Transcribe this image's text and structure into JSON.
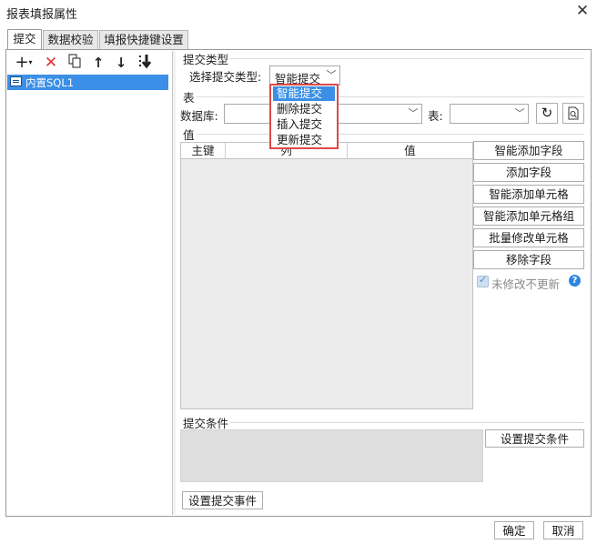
{
  "window": {
    "title": "报表填报属性"
  },
  "tabs": [
    "提交",
    "数据校验",
    "填报快捷键设置"
  ],
  "left": {
    "items": [
      {
        "label": "内置SQL1",
        "selected": true
      }
    ]
  },
  "submit_type": {
    "section_label": "提交类型",
    "select_label": "选择提交类型:",
    "value": "智能提交",
    "options": [
      "智能提交",
      "删除提交",
      "插入提交",
      "更新提交"
    ]
  },
  "table_section": {
    "label": "表",
    "database_label": "数据库:",
    "table_label": "表:"
  },
  "value_section": {
    "label": "值",
    "columns": [
      "主键",
      "列",
      "值"
    ],
    "buttons": [
      "智能添加字段",
      "添加字段",
      "智能添加单元格",
      "智能添加单元格组",
      "批量修改单元格",
      "移除字段"
    ],
    "checkbox_label": "未修改不更新",
    "checkbox_checked": true
  },
  "condition": {
    "label": "提交条件",
    "button": "设置提交条件"
  },
  "event_button": "设置提交事件",
  "footer": {
    "ok": "确定",
    "cancel": "取消"
  }
}
